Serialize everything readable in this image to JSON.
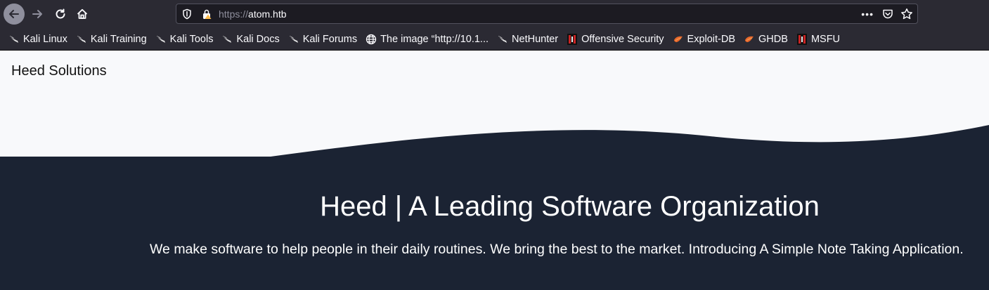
{
  "browser": {
    "url_scheme": "https://",
    "url_host": "atom.htb",
    "page_actions_dots": "•••",
    "bookmarks": [
      {
        "label": "Kali Linux",
        "icon": "kali-dragon-icon"
      },
      {
        "label": "Kali Training",
        "icon": "kali-dragon-icon"
      },
      {
        "label": "Kali Tools",
        "icon": "kali-dragon-icon"
      },
      {
        "label": "Kali Docs",
        "icon": "kali-dragon-icon"
      },
      {
        "label": "Kali Forums",
        "icon": "kali-dragon-icon"
      },
      {
        "label": "The image “http://10.1...",
        "icon": "globe-icon"
      },
      {
        "label": "NetHunter",
        "icon": "kali-dragon-icon"
      },
      {
        "label": "Offensive Security",
        "icon": "offsec-icon"
      },
      {
        "label": "Exploit-DB",
        "icon": "exploit-db-icon"
      },
      {
        "label": "GHDB",
        "icon": "exploit-db-icon"
      },
      {
        "label": "MSFU",
        "icon": "offsec-icon"
      }
    ],
    "colors": {
      "chrome_bg": "#2b2a33",
      "urlbar_bg": "#1c1b22"
    }
  },
  "site": {
    "brand": "Heed Solutions",
    "headline": "Heed | A Leading Software Organization",
    "tagline": "We make software to help people in their daily routines. We bring the best to the market. Introducing A Simple Note Taking Application.",
    "colors": {
      "hero_top": "#f8f9fb",
      "hero_dark": "#1b2333"
    }
  }
}
